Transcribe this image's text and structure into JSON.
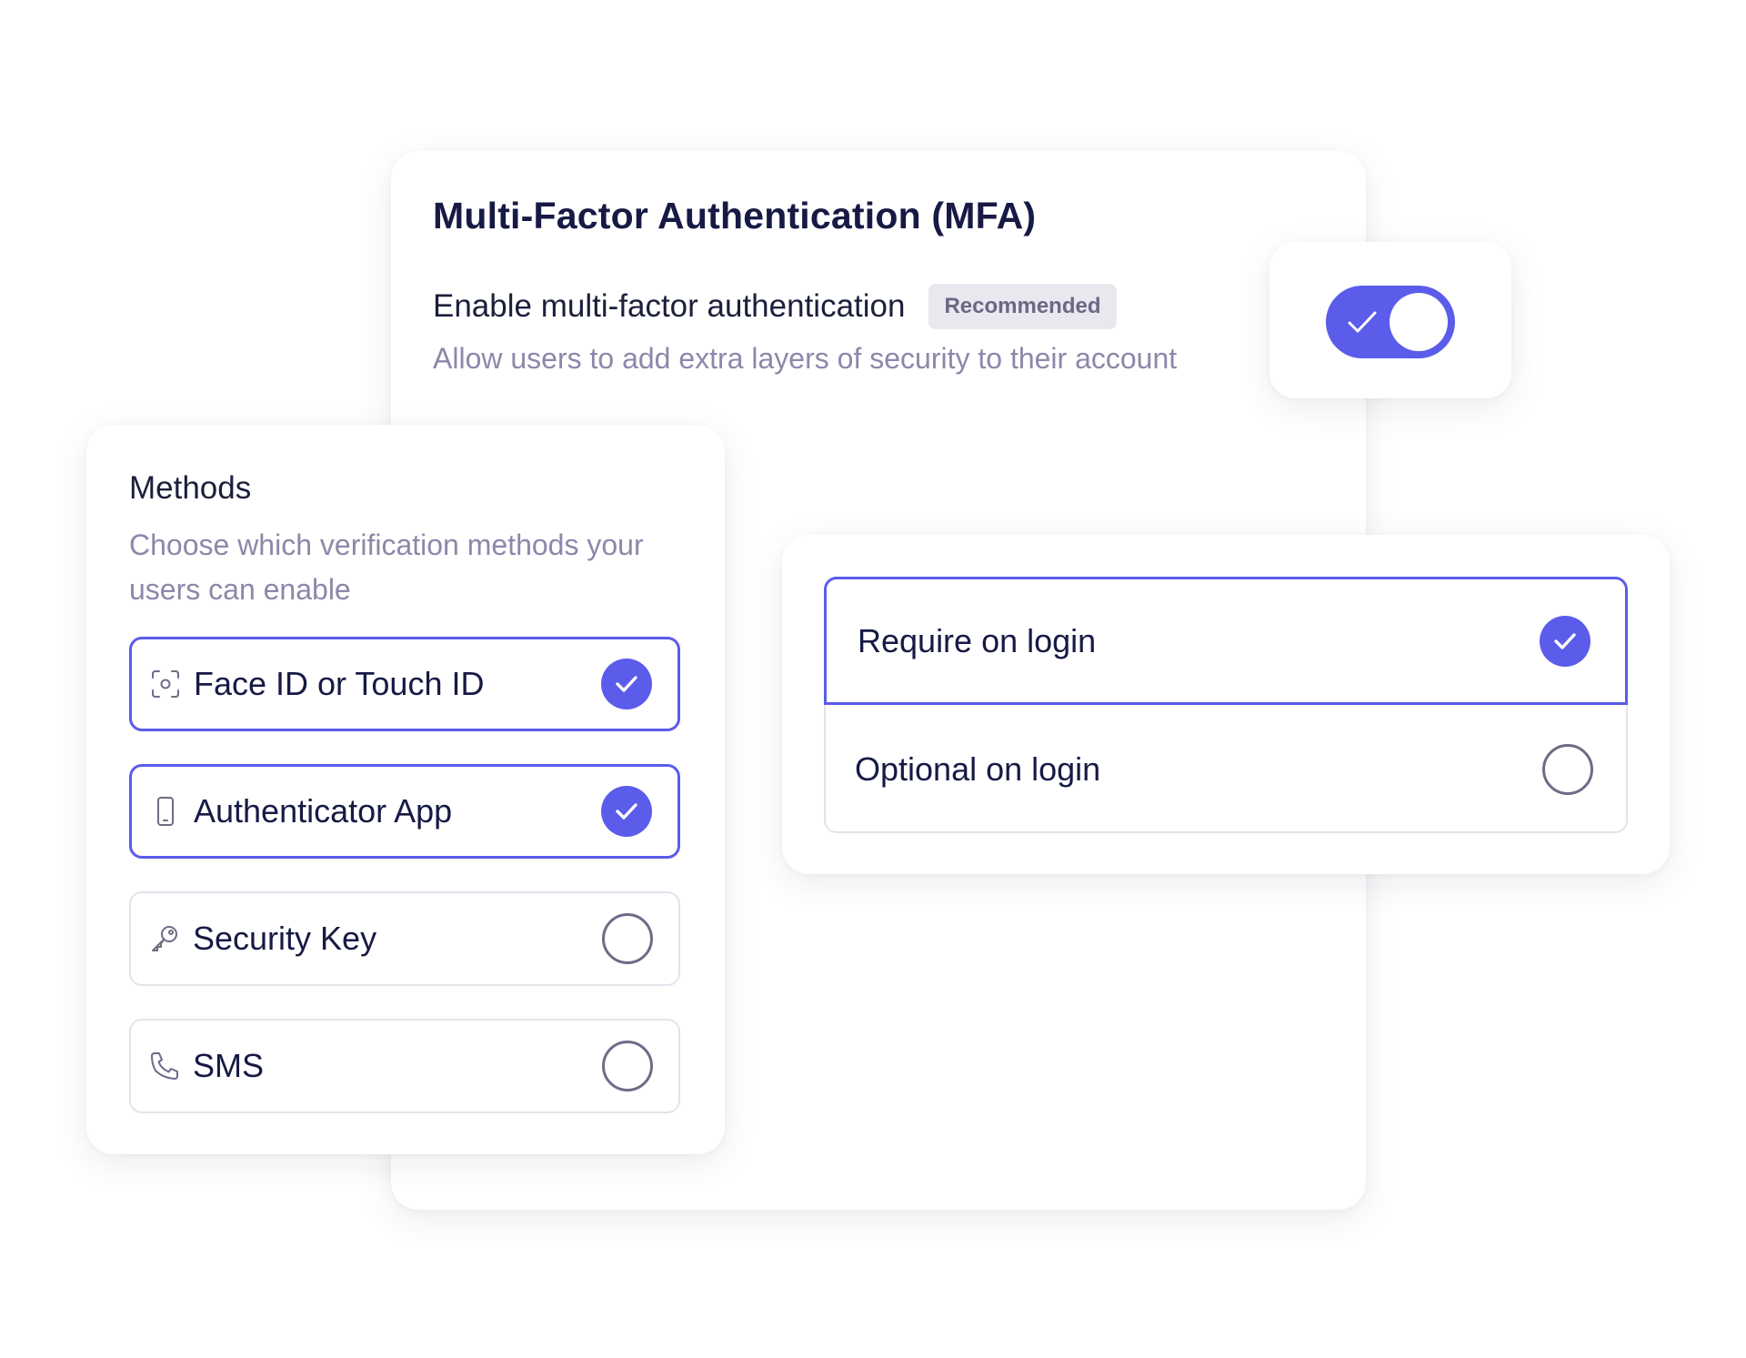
{
  "colors": {
    "accent": "#5b5cea",
    "heading": "#161a44",
    "muted": "#8c88aa",
    "badge_bg": "#e9e8ef"
  },
  "mfa": {
    "title": "Multi-Factor Authentication (MFA)",
    "enable_label": "Enable multi-factor authentication",
    "badge": "Recommended",
    "description": "Allow users to add extra layers of security to their account",
    "toggle_on": true
  },
  "methods": {
    "title": "Methods",
    "description": "Choose which verification methods your users can enable",
    "items": [
      {
        "label": "Face ID or Touch ID",
        "icon": "face-id-icon",
        "checked": true
      },
      {
        "label": "Authenticator App",
        "icon": "phone-icon",
        "checked": true
      },
      {
        "label": "Security Key",
        "icon": "key-icon",
        "checked": false
      },
      {
        "label": "SMS",
        "icon": "telephone-icon",
        "checked": false
      }
    ]
  },
  "login": {
    "options": [
      {
        "label": "Require on login",
        "checked": true
      },
      {
        "label": "Optional on login",
        "checked": false
      }
    ]
  }
}
